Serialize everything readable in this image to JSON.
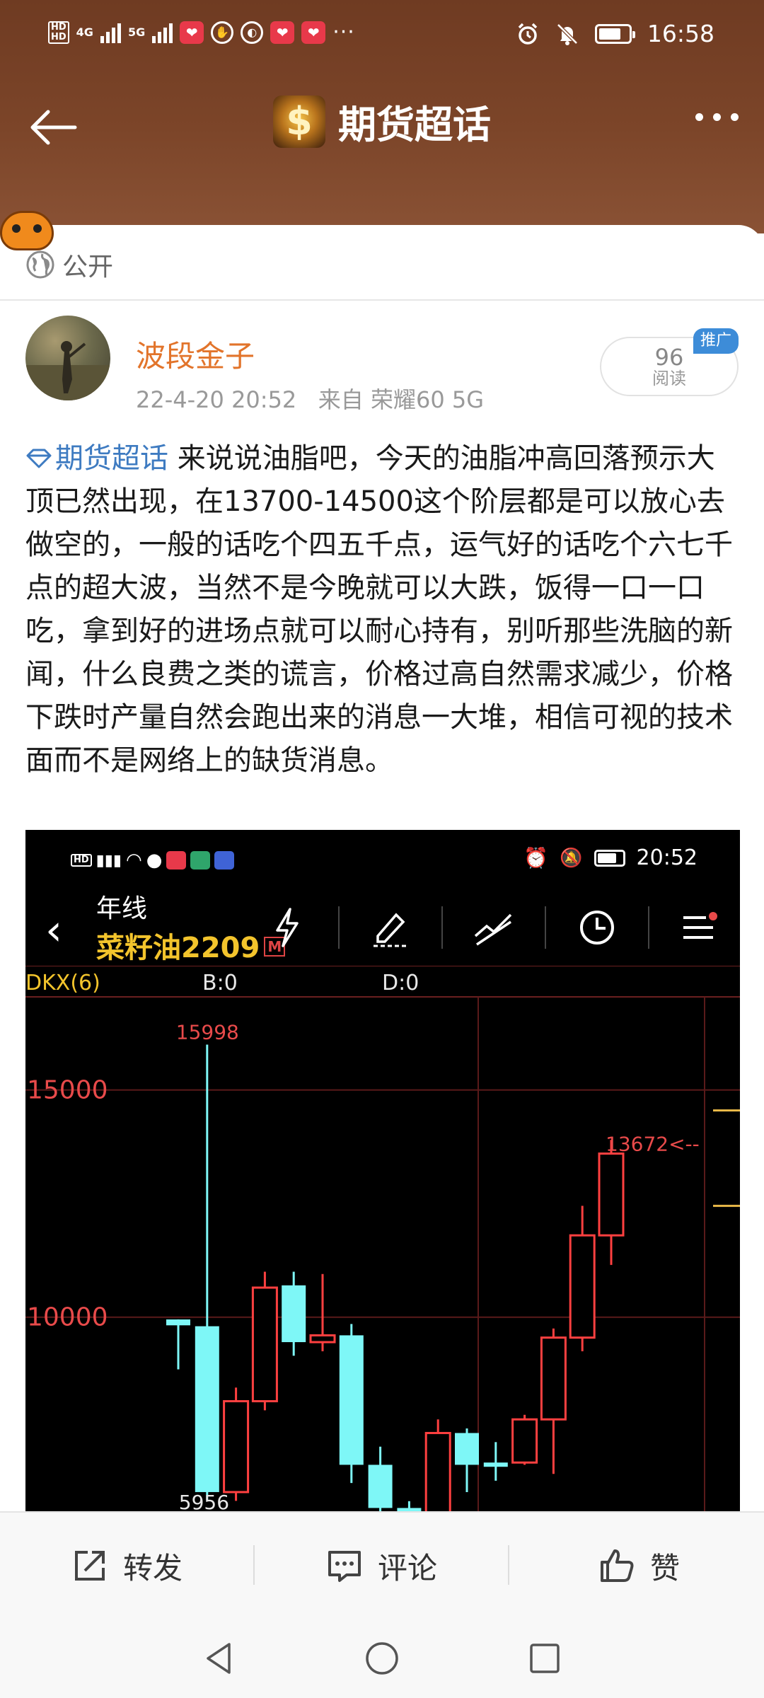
{
  "status_bar": {
    "network_labels": [
      "4G",
      "5G"
    ],
    "time": "16:58",
    "icons": [
      "alarm-icon",
      "mute-icon",
      "battery-icon"
    ]
  },
  "nav": {
    "title": "期货超话",
    "back_icon": "arrow-left-icon",
    "more_icon": "more-dots-icon"
  },
  "card": {
    "visibility_label": "公开"
  },
  "post": {
    "author": "波段金子",
    "timestamp": "22-4-20 20:52",
    "source": "来自 荣耀60 5G",
    "read_count": "96",
    "read_label": "阅读",
    "promo_badge": "推广",
    "topic": "期货超话",
    "body": " 来说说油脂吧，今天的油脂冲高回落预示大顶已然出现，在13700-14500这个阶层都是可以放心去做空的，一般的话吃个四五千点，运气好的话吃个六七千点的超大波，当然不是今晚就可以大跌，饭得一口一口吃，拿到好的进场点就可以耐心持有，别听那些洗脑的新闻，什么良费之类的谎言，价格过高自然需求减少，价格下跌时产量自然会跑出来的消息一大堆，相信可视的技术面而不是网络上的缺货消息。"
  },
  "embedded_screenshot": {
    "status_time": "20:52",
    "period": "年线",
    "symbol": "菜籽油2209",
    "symbol_badge": "M",
    "indicator_name": "DKX(6)",
    "indicator_b": "B:0",
    "indicator_d": "D:0",
    "toolbar_icons": [
      "lightning-icon",
      "draw-pen-icon",
      "trend-line-icon",
      "clock-icon",
      "menu-list-icon"
    ]
  },
  "chart_data": {
    "type": "candlestick",
    "y_tick_labels": [
      "15000",
      "10000"
    ],
    "ylim": [
      5900,
      16800
    ],
    "high_label": "15998",
    "low_label_partial": "5956",
    "last_label": "13672<--",
    "candles": [
      {
        "open": 9950,
        "close": 9820,
        "high": 9950,
        "low": 8850,
        "color": "cyan"
      },
      {
        "open": 9800,
        "close": 6150,
        "high": 15998,
        "low": 5956,
        "color": "cyan"
      },
      {
        "open": 6150,
        "close": 8150,
        "high": 8450,
        "low": 5956,
        "color": "red"
      },
      {
        "open": 8150,
        "close": 10650,
        "high": 11000,
        "low": 7950,
        "color": "red"
      },
      {
        "open": 10700,
        "close": 9450,
        "high": 11000,
        "low": 9150,
        "color": "cyan"
      },
      {
        "open": 9450,
        "close": 9600,
        "high": 10950,
        "low": 9250,
        "color": "red"
      },
      {
        "open": 9600,
        "close": 6750,
        "high": 9850,
        "low": 6350,
        "color": "cyan"
      },
      {
        "open": 6750,
        "close": 5800,
        "high": 7150,
        "low": 5400,
        "color": "cyan"
      },
      {
        "open": 5800,
        "close": 5500,
        "high": 5950,
        "low": 5300,
        "color": "cyan"
      },
      {
        "open": 5700,
        "close": 7450,
        "high": 7750,
        "low": 5500,
        "color": "red"
      },
      {
        "open": 7450,
        "close": 6750,
        "high": 7550,
        "low": 6150,
        "color": "cyan"
      },
      {
        "open": 6800,
        "close": 6800,
        "high": 7250,
        "low": 6400,
        "color": "cyan"
      },
      {
        "open": 6800,
        "close": 7750,
        "high": 7850,
        "low": 6750,
        "color": "red"
      },
      {
        "open": 7750,
        "close": 9550,
        "high": 9750,
        "low": 6550,
        "color": "red"
      },
      {
        "open": 9550,
        "close": 11800,
        "high": 12450,
        "low": 9250,
        "color": "red"
      },
      {
        "open": 11800,
        "close": 13600,
        "high": 13900,
        "low": 11150,
        "color": "red"
      }
    ]
  },
  "actions": {
    "repost_label": "转发",
    "comment_label": "评论",
    "like_label": "赞"
  },
  "system_nav": {
    "icons": [
      "nav-back-icon",
      "nav-home-icon",
      "nav-recents-icon"
    ]
  }
}
